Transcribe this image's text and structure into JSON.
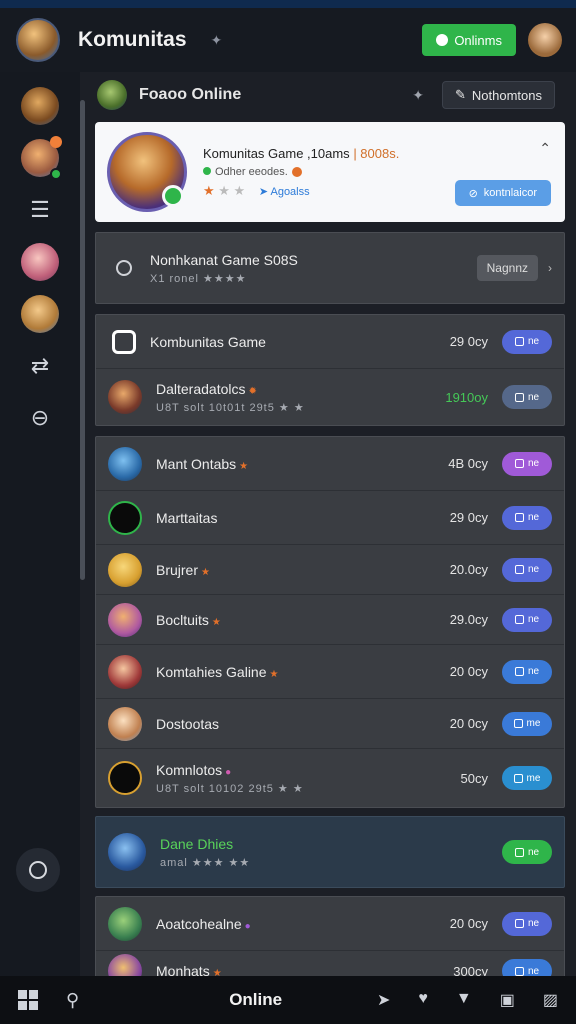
{
  "topbar": {
    "title": "Komunitas",
    "online_label": "Onlinms"
  },
  "section": {
    "title": "Foaoo Online",
    "notif_label": "Nothomtons"
  },
  "feature": {
    "title": "Komunitas Game ,10ams",
    "count": "| 8008s.",
    "sub": "Odher eeodes.",
    "link": "Agoalss",
    "button": "kontnlaicor"
  },
  "groups": [
    {
      "rows": [
        {
          "name": "Nonhkanat Game S08S",
          "sub": "X1 ronel ★★★★",
          "nav": "Nagnnz"
        }
      ]
    },
    {
      "rows": [
        {
          "name": "Kombunitas Game",
          "time": "29 0cy",
          "tag": "ne"
        },
        {
          "name": "Dalteradatolcs",
          "sub": "U8T solt 10t01t 29t5 ★ ★",
          "time": "1910oy",
          "tag": "ne"
        }
      ]
    },
    {
      "rows": [
        {
          "name": "Mant Ontabs",
          "time": "4B 0cy",
          "tag": "ne"
        },
        {
          "name": "Marttaitas",
          "time": "29 0cy",
          "tag": "ne"
        },
        {
          "name": "Brujrer",
          "time": "20.0cy",
          "tag": "ne"
        },
        {
          "name": "Bocltuits",
          "time": "29.0cy",
          "tag": "ne"
        },
        {
          "name": "Komtahies Galine",
          "time": "20 0cy",
          "tag": "ne"
        },
        {
          "name": "Dostootas",
          "time": "20 0cy",
          "tag": "me"
        },
        {
          "name": "Komnlotos",
          "sub": "U8T solt 10102 29t5 ★ ★",
          "time": "50cy",
          "tag": "me"
        }
      ]
    },
    {
      "rows": [
        {
          "name": "Dane Dhies",
          "sub": "amal ★★★ ★★",
          "tag": "ne"
        }
      ]
    },
    {
      "rows": [
        {
          "name": "Aoatcohealne",
          "time": "20 0cy",
          "tag": "ne"
        },
        {
          "name": "Monhats",
          "time": "300cy",
          "tag": "ne"
        }
      ]
    }
  ],
  "taskbar": {
    "online": "Online"
  },
  "colors": {
    "accent_green": "#2fb54a",
    "tag_blue": "#5468d8",
    "tag_purple": "#a05ad8",
    "tag_teal": "#2a8fd0"
  }
}
